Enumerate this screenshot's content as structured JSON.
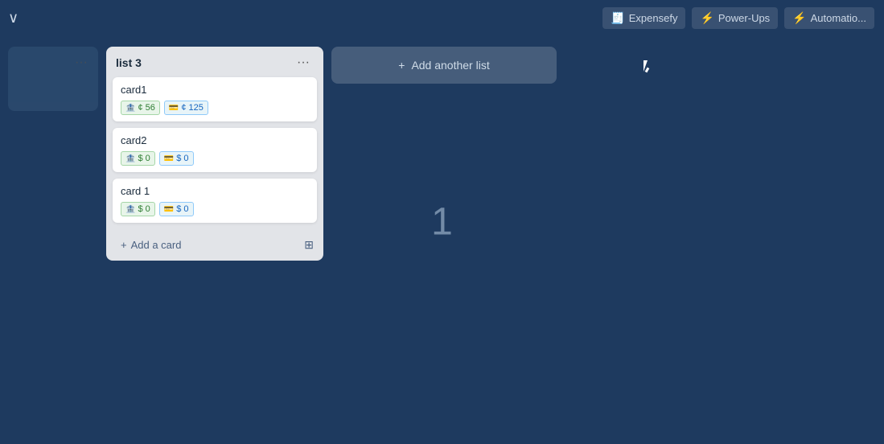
{
  "topbar": {
    "chevron_label": "❮",
    "items": [
      {
        "id": "expensefy",
        "icon": "🧾",
        "label": "Expensefy"
      },
      {
        "id": "power-ups",
        "icon": "⚡",
        "label": "Power-Ups"
      },
      {
        "id": "automation",
        "icon": "⚡",
        "label": "Automatio..."
      }
    ]
  },
  "board": {
    "big_number": "1",
    "lists": [
      {
        "id": "list-partial",
        "title": "",
        "partial": true,
        "cards": []
      },
      {
        "id": "list3",
        "title": "list 3",
        "partial": false,
        "cards": [
          {
            "id": "card1",
            "title": "card1",
            "badges": [
              {
                "type": "budget",
                "icon": "🏦",
                "value": "¢ 56"
              },
              {
                "type": "spent",
                "icon": "💳",
                "value": "¢ 125"
              }
            ]
          },
          {
            "id": "card2",
            "title": "card2",
            "badges": [
              {
                "type": "budget",
                "icon": "🏦",
                "value": "$ 0"
              },
              {
                "type": "spent",
                "icon": "💳",
                "value": "$ 0"
              }
            ]
          },
          {
            "id": "card-1",
            "title": "card 1",
            "badges": [
              {
                "type": "budget",
                "icon": "🏦",
                "value": "$ 0"
              },
              {
                "type": "spent",
                "icon": "💳",
                "value": "$ 0"
              }
            ]
          }
        ],
        "add_card_label": "Add a card",
        "menu_dots": "···"
      }
    ],
    "add_list_label": "Add another list",
    "add_list_icon": "+"
  }
}
